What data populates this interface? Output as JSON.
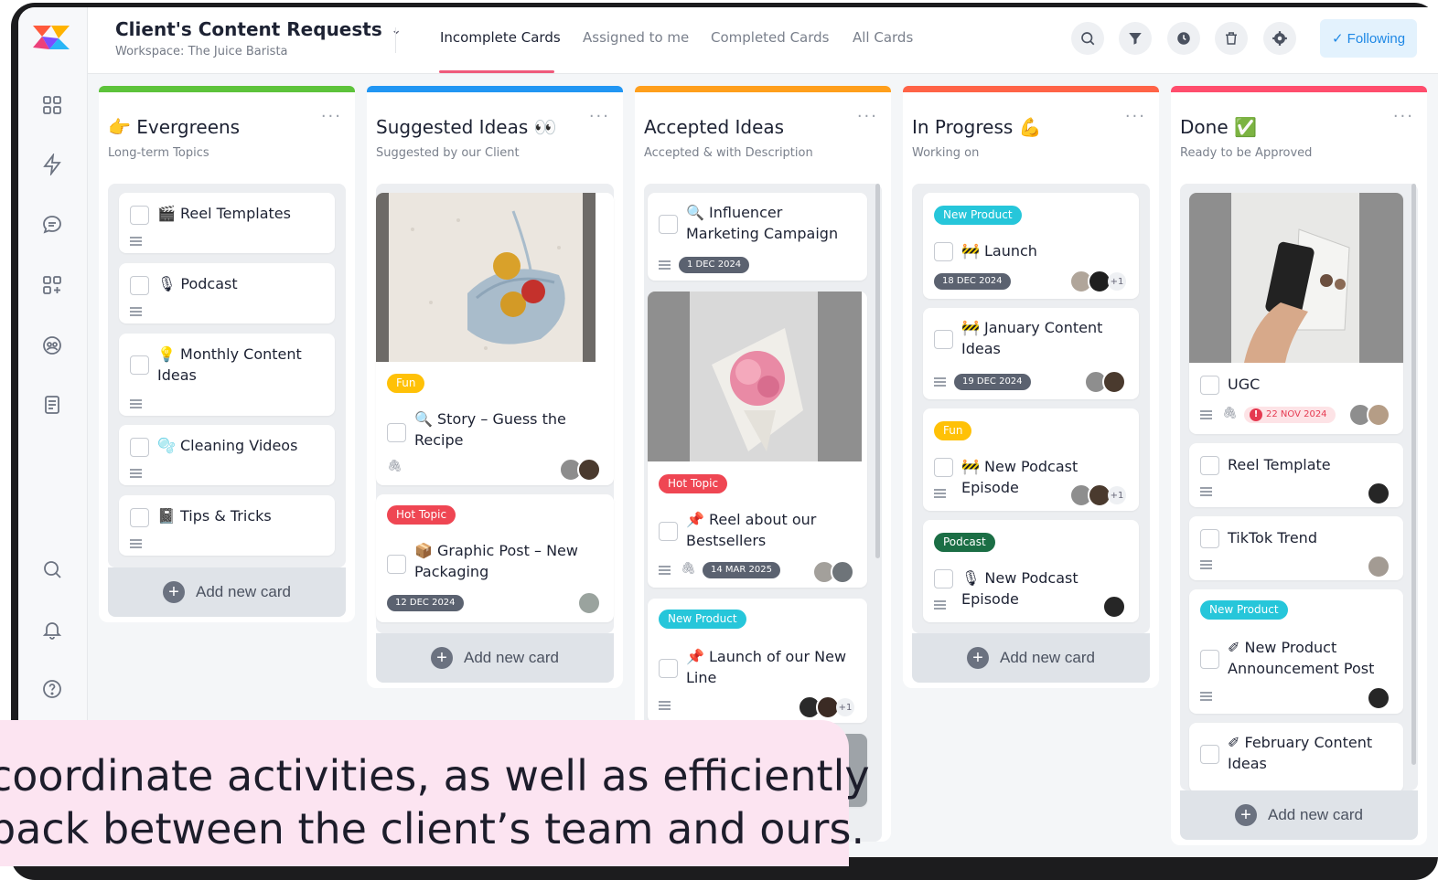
{
  "header": {
    "title": "Client's Content Requests",
    "workspace": "Workspace: The Juice Barista",
    "tabs": [
      "Incomplete Cards",
      "Assigned to me",
      "Completed Cards",
      "All Cards"
    ],
    "following_label": "✓ Following",
    "icons": [
      "search-icon",
      "filter-icon",
      "clock-icon",
      "trash-icon",
      "gear-icon"
    ]
  },
  "sidebar": {
    "icons": [
      "dashboard-icon",
      "lightning-icon",
      "chat-icon",
      "apps-add-icon",
      "users-icon",
      "document-icon",
      "search-icon",
      "bell-icon",
      "help-icon"
    ]
  },
  "columns": [
    {
      "title": "👉 Evergreens",
      "subtitle": "Long-term Topics",
      "color": "#5dc33b",
      "cards": [
        {
          "title": "🎬 Reel Templates"
        },
        {
          "title": "🎙 Podcast"
        },
        {
          "title": "💡 Monthly Content Ideas"
        },
        {
          "title": "🫧 Cleaning Videos"
        },
        {
          "title": "📓 Tips & Tricks"
        }
      ],
      "add_label": "Add new card"
    },
    {
      "title": "Suggested Ideas 👀",
      "subtitle": "Suggested by our Client",
      "color": "#2196f3",
      "cards": [
        {
          "tag": "Fun",
          "title": "🔍 Story – Guess the Recipe"
        },
        {
          "tag": "Hot Topic",
          "title": "📦 Graphic Post – New Packaging",
          "date": "12 DEC 2024"
        }
      ],
      "add_label": "Add new card"
    },
    {
      "title": "Accepted Ideas",
      "subtitle": "Accepted & with Description",
      "color": "#ff9f1c",
      "cards": [
        {
          "title": "🔍 Influencer Marketing Campaign",
          "date": "1 DEC 2024"
        },
        {
          "tag": "Hot Topic",
          "title": "📌 Reel about our Bestsellers",
          "date": "14 MAR 2025"
        },
        {
          "tag": "New Product",
          "title": "📌 Launch of our New Line",
          "more": "+1"
        }
      ]
    },
    {
      "title": "In Progress 💪",
      "subtitle": "Working on",
      "color": "#ff6347",
      "cards": [
        {
          "tag": "New Product",
          "title": "🚧 Launch",
          "date": "18 DEC 2024",
          "more": "+1"
        },
        {
          "title": "🚧 January Content Ideas",
          "date": "19 DEC 2024"
        },
        {
          "tag": "Fun",
          "title": "🚧 New Podcast Episode",
          "more": "+1"
        },
        {
          "tag": "Podcast",
          "title": "🎙 New Podcast Episode"
        }
      ],
      "add_label": "Add new card"
    },
    {
      "title": "Done ✅",
      "subtitle": "Ready to be Approved",
      "color": "#ff4d6d",
      "cards": [
        {
          "title": "UGC",
          "date": "22 NOV 2024"
        },
        {
          "title": "Reel Template"
        },
        {
          "title": "TikTok Trend"
        },
        {
          "tag": "New Product",
          "title": "✐ New Product Announcement Post"
        },
        {
          "title": "✐ February Content Ideas"
        }
      ],
      "add_label": "Add new card"
    }
  ],
  "caption": {
    "line1": "coordinate activities, as well as efficiently",
    "line2": "back between the client’s team and ours."
  },
  "colors": {
    "fun": "#ffc107",
    "hot_topic": "#ef4653",
    "new_product": "#26c6da",
    "podcast": "#1b6e45",
    "accent": "#1e88e5"
  }
}
